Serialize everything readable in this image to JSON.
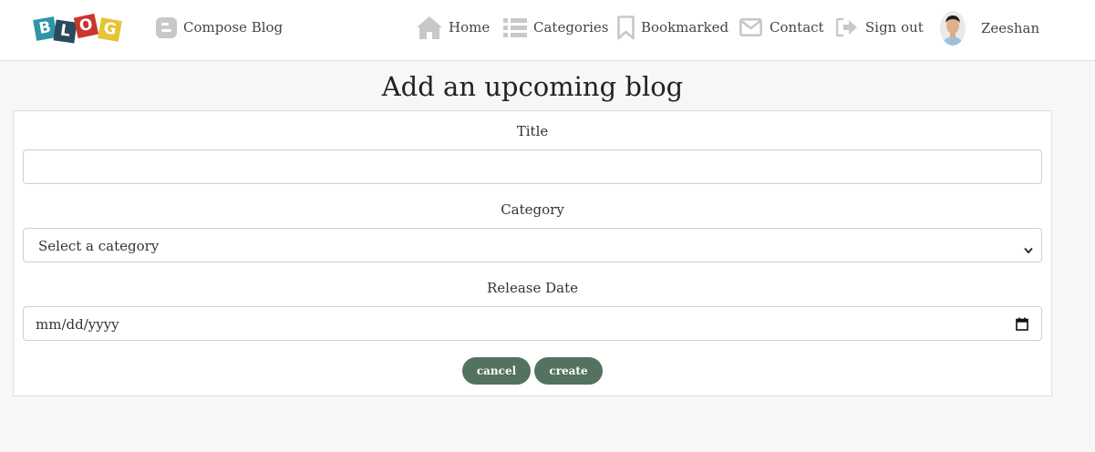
{
  "nav": {
    "logo_letters": [
      "B",
      "L",
      "O",
      "G"
    ],
    "logo_colors": [
      "#2e96a6",
      "#2b4a5c",
      "#c8372d",
      "#e5c435"
    ],
    "compose": "Compose Blog",
    "home": "Home",
    "categories": "Categories",
    "bookmarked": "Bookmarked",
    "contact": "Contact",
    "signout": "Sign out",
    "user": "Zeeshan"
  },
  "page": {
    "title": "Add an upcoming blog"
  },
  "form": {
    "title_label": "Title",
    "title_value": "",
    "category_label": "Category",
    "category_selected": "Select a category",
    "date_label": "Release Date",
    "date_placeholder": "mm/dd/yyyy",
    "cancel_label": "cancel",
    "create_label": "create"
  },
  "colors": {
    "button": "#53725f",
    "icon": "#c8c8c8"
  }
}
